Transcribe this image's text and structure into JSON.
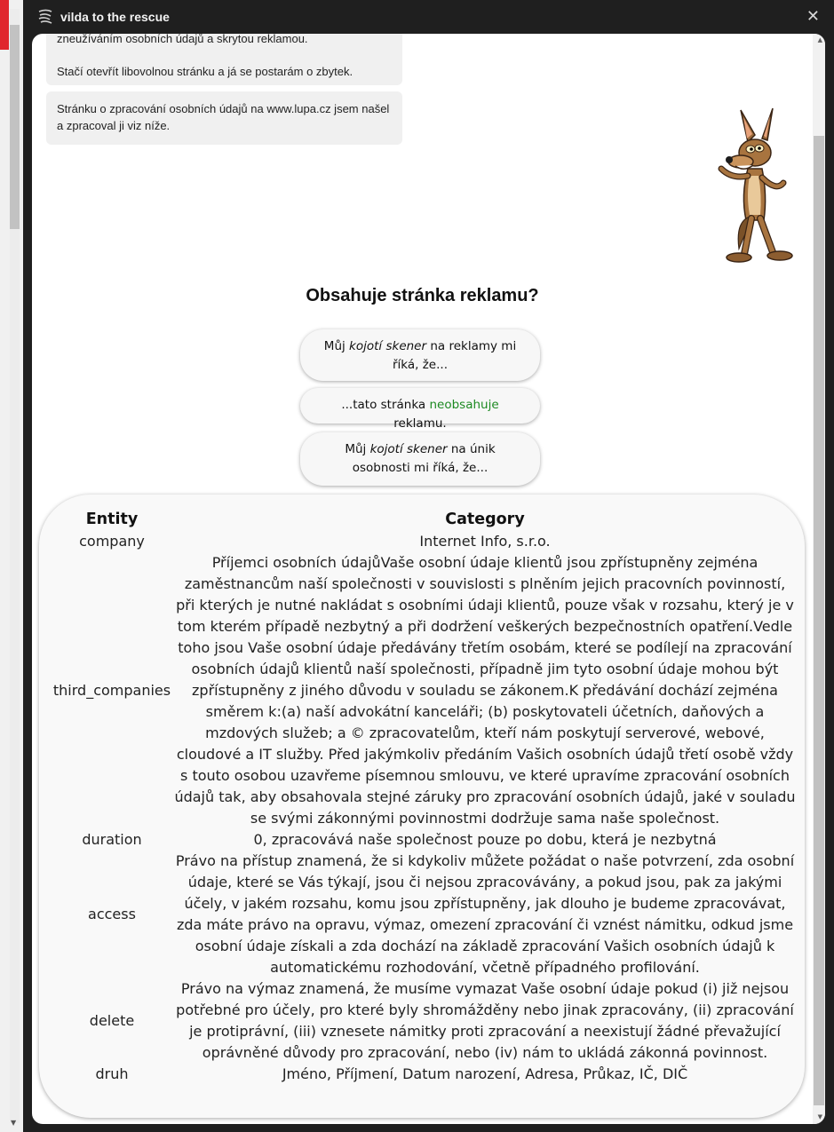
{
  "panel": {
    "title": "vilda to the rescue",
    "close_glyph": "✕",
    "icon": "vilda-swirl-icon"
  },
  "messages": {
    "intro_cut": "zneužíváním osobních údajů a skrytou reklamou.",
    "intro_action": "Stačí otevřít libovolnou stránku a já se postarám o zbytek.",
    "found": "Stránku o zpracování osobních údajů na www.lupa.cz jsem našel a zpracoval ji viz níže."
  },
  "ads_section": {
    "heading": "Obsahuje stránka reklamu?",
    "bubble1_prefix": "Můj ",
    "bubble1_em": "kojotí skener",
    "bubble1_suffix": " na reklamy mi říká, že...",
    "bubble2_prefix": "...tato stránka ",
    "bubble2_highlight": "neobsahuje",
    "bubble2_suffix": " reklamu.",
    "bubble3_prefix": "Můj ",
    "bubble3_em": "kojotí skener",
    "bubble3_suffix": " na únik osobnosti mi říká, že...",
    "highlight_color": "#1d8a22"
  },
  "table": {
    "headers": [
      "Entity",
      "Category"
    ],
    "rows": [
      {
        "entity": "company",
        "category": "Internet Info, s.r.o."
      },
      {
        "entity": "third_companies",
        "category": "Příjemci osobních údajůVaše osobní údaje klientů jsou zpřístupněny zejména zaměstnancům naší společnosti v souvislosti s plněním jejich pracovních povinností, při kterých je nutné nakládat s osobními údaji klientů, pouze však v rozsahu, který je v tom kterém případě nezbytný a při dodržení veškerých bezpečnostních opatření.Vedle toho jsou Vaše osobní údaje předávány třetím osobám, které se podílejí na zpracování osobních údajů klientů naší společnosti, případně jim tyto osobní údaje mohou být zpřístupněny z jiného důvodu v souladu se zákonem.K předávání dochází zejména směrem k:(a) naší advokátní kanceláři; (b) poskytovateli účetních, daňových a mzdových služeb; a © zpracovatelům, kteří nám poskytují serverové, webové, cloudové a IT služby. Před jakýmkoliv předáním Vašich osobních údajů třetí osobě vždy s touto osobou uzavřeme písemnou smlouvu, ve které upravíme zpracování osobních údajů tak, aby obsahovala stejné záruky pro zpracování osobních údajů, jaké v souladu se svými zákonnými povinnostmi dodržuje sama naše společnost."
      },
      {
        "entity": "duration",
        "category": "0, zpracovává naše společnost pouze po dobu, která je nezbytná"
      },
      {
        "entity": "access",
        "category": "Právo na přístup znamená, že si kdykoliv můžete požádat o naše potvrzení, zda osobní údaje, které se Vás týkají, jsou či nejsou zpracovávány, a pokud jsou, pak za jakými účely, v jakém rozsahu, komu jsou zpřístupněny, jak dlouho je budeme zpracovávat, zda máte právo na opravu, výmaz, omezení zpracování či vznést námitku, odkud jsme osobní údaje získali a zda dochází na základě zpracování Vašich osobních údajů k automatickému rozhodování, včetně případného profilování."
      },
      {
        "entity": "delete",
        "category": "Právo na výmaz znamená, že musíme vymazat Vaše osobní údaje pokud (i) již nejsou potřebné pro účely, pro které byly shromážděny nebo jinak zpracovány, (ii) zpracování je protiprávní, (iii) vznesete námitky proti zpracování a neexistují žádné převažující oprávněné důvody pro zpracování, nebo (iv) nám to ukládá zákonná povinnost."
      },
      {
        "entity": "druh",
        "category": "Jméno, Příjmení, Datum narození, Adresa, Průkaz, IČ, DIČ"
      }
    ]
  }
}
